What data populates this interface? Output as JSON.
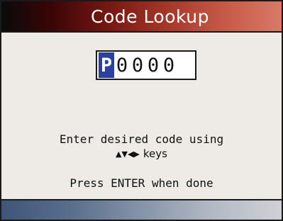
{
  "title": "Code Lookup",
  "code_entry": {
    "selected_char": "P",
    "chars": [
      "0",
      "0",
      "0",
      "0"
    ]
  },
  "instructions": {
    "line1": "Enter desired code using",
    "arrow_up": "▲",
    "arrow_down": "▼",
    "arrow_left": "◀",
    "arrow_right": "▶",
    "keys_word": "keys"
  },
  "prompt": "Press ENTER when done",
  "colors": {
    "selection": "#2d3f9e",
    "title_gradient_start": "#0a0a0a",
    "title_gradient_end": "#d77a66",
    "bottom_gradient_start": "#3e5578",
    "bottom_gradient_end": "#cfd1d5"
  }
}
